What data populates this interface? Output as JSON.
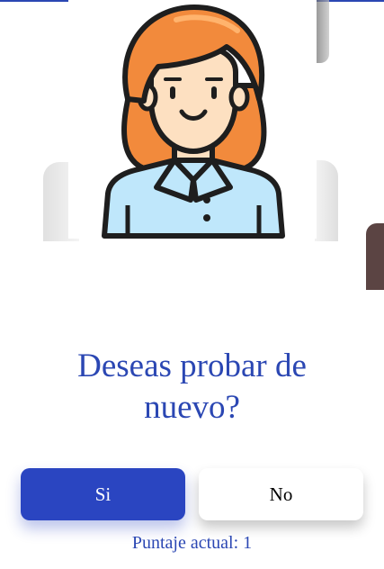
{
  "dialog": {
    "question": "Deseas probar de nuevo?",
    "yes_label": "Si",
    "no_label": "No",
    "score_text": "Puntaje actual: 1"
  },
  "avatar": {
    "icon": "woman-avatar-icon",
    "hair_color": "#f28a3c",
    "skin_color": "#fde0c1",
    "shirt_color": "#bfe7fb"
  },
  "colors": {
    "accent": "#2b47b3",
    "primary_button": "#2a45c1"
  }
}
